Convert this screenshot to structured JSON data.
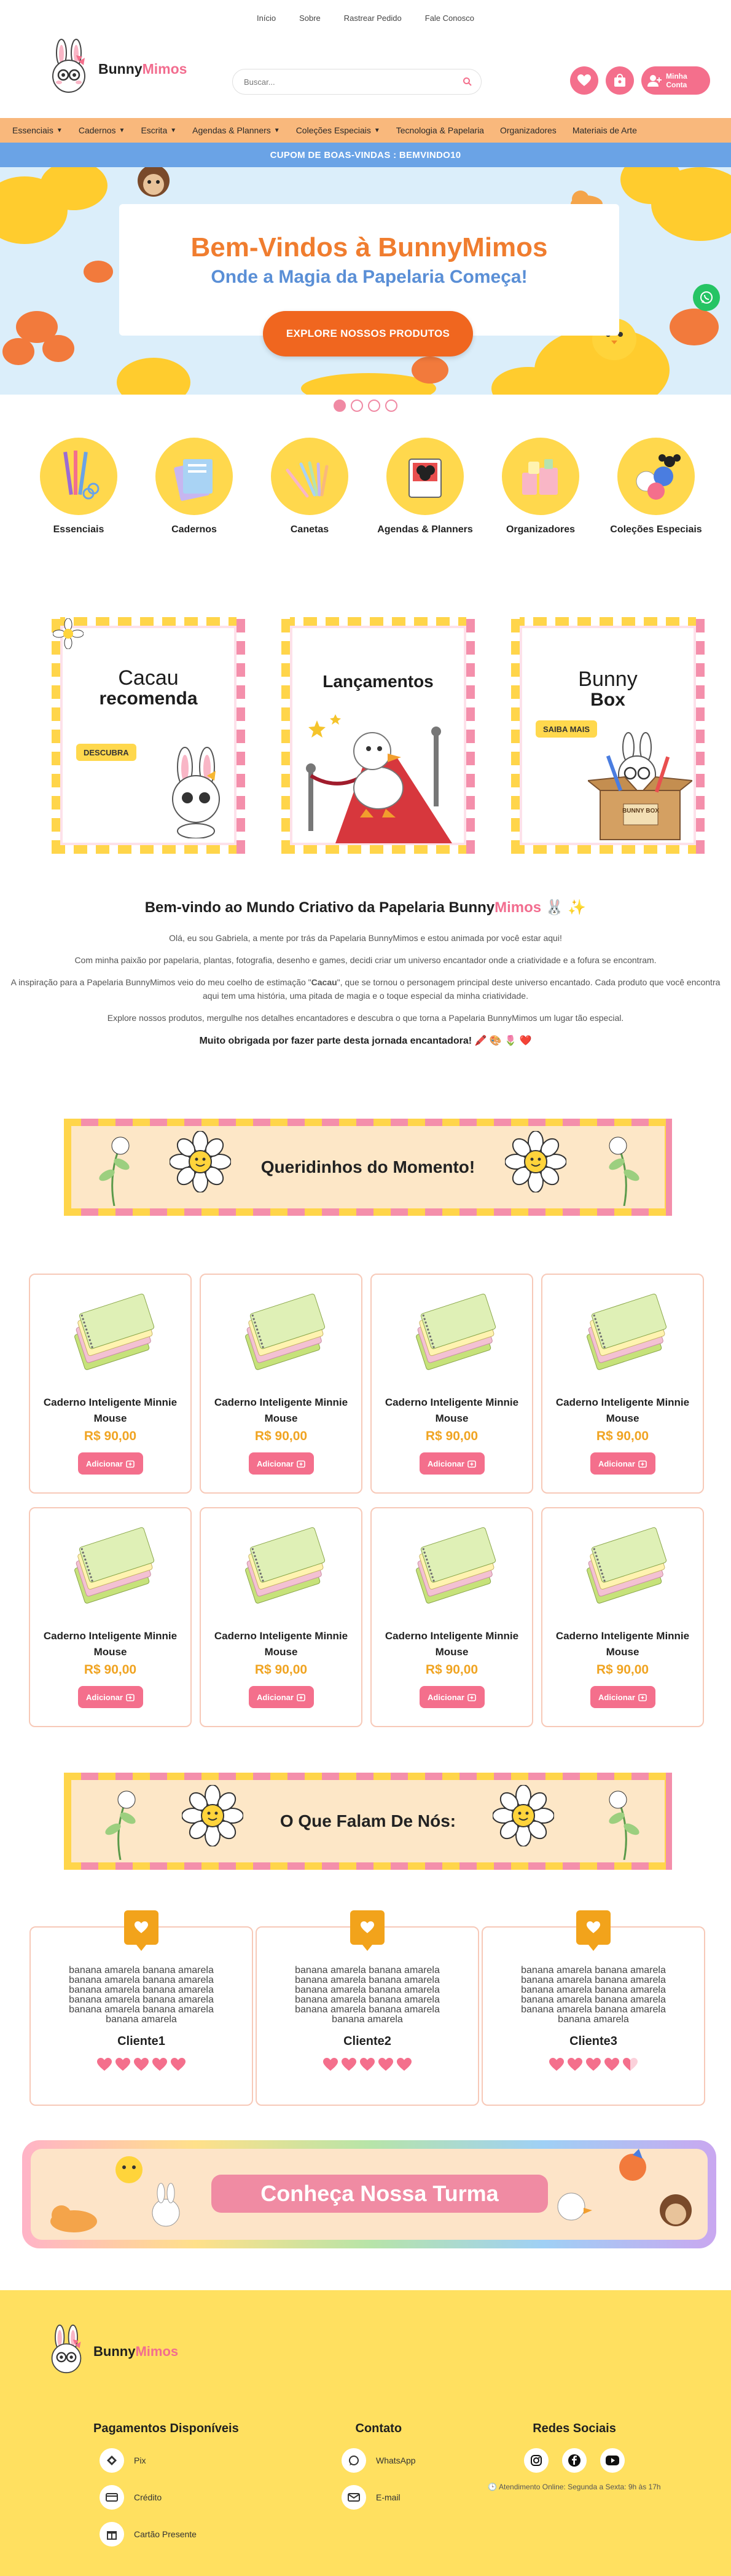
{
  "top_links": [
    "Início",
    "Sobre",
    "Rastrear Pedido",
    "Fale Conosco"
  ],
  "brand": {
    "name_a": "Bunny",
    "name_b": "Mimos"
  },
  "search": {
    "placeholder": "Buscar..."
  },
  "account": {
    "line1": "Minha",
    "line2": "Conta"
  },
  "category_nav": [
    {
      "label": "Essenciais",
      "has_menu": true
    },
    {
      "label": "Cadernos",
      "has_menu": true
    },
    {
      "label": "Escrita",
      "has_menu": true
    },
    {
      "label": "Agendas & Planners",
      "has_menu": true
    },
    {
      "label": "Coleções Especiais",
      "has_menu": true
    },
    {
      "label": "Tecnologia & Papelaria",
      "has_menu": false
    },
    {
      "label": "Organizadores",
      "has_menu": false
    },
    {
      "label": "Materiais de Arte",
      "has_menu": false
    }
  ],
  "coupon": "CUPOM DE BOAS-VINDAS : BEMVINDO10",
  "hero": {
    "title": "Bem-Vindos à BunnyMimos",
    "subtitle": "Onde a Magia da Papelaria Começa!",
    "cta": "EXPLORE NOSSOS PRODUTOS",
    "slides": 4,
    "active_slide": 1
  },
  "categories": [
    {
      "label": "Essenciais"
    },
    {
      "label": "Cadernos"
    },
    {
      "label": "Canetas"
    },
    {
      "label": "Agendas & Planners"
    },
    {
      "label": "Organizadores"
    },
    {
      "label": "Coleções Especiais"
    }
  ],
  "promos": [
    {
      "title_a": "Cacau",
      "title_b": "recomenda",
      "tag": "DESCUBRA"
    },
    {
      "title_a": "Lançamentos",
      "title_b": "",
      "tag": ""
    },
    {
      "title_a": "Bunny",
      "title_b": "Box",
      "tag": "SAIBA MAIS",
      "box_label": "BUNNY BOX"
    }
  ],
  "welcome": {
    "title_a": "Bem-vindo ao Mundo Criativo da Papelaria Bunny",
    "title_b": "Mimos",
    "title_emoji": "🐰 ✨",
    "p1": "Olá, eu sou Gabriela, a mente por trás da Papelaria BunnyMimos e estou animada por você estar aqui!",
    "p2": "Com minha paixão por papelaria, plantas, fotografia, desenho e games, decidi criar um universo encantador onde a criatividade e a fofura se encontram.",
    "p3a": "A inspiração para a Papelaria BunnyMimos veio do meu coelho de estimação \"",
    "p3b": "Cacau",
    "p3c": "\", que se tornou o personagem principal deste universo encantado. Cada produto que você encontra aqui tem uma história, uma pitada de magia e o toque especial da minha criatividade.",
    "p4": "Explore nossos produtos, mergulhe nos detalhes encantadores e descubra o que torna a Papelaria BunnyMimos um lugar tão especial.",
    "thanks": "Muito obrigada por fazer parte desta jornada encantadora! 🖍️ 🎨 🌷 ❤️"
  },
  "section_titles": {
    "favorites": "Queridinhos do Momento!",
    "reviews": "O Que Falam De Nós:"
  },
  "products": [
    {
      "name": "Caderno Inteligente Minnie Mouse",
      "price": "R$ 90,00",
      "button": "Adicionar"
    },
    {
      "name": "Caderno Inteligente Minnie Mouse",
      "price": "R$ 90,00",
      "button": "Adicionar"
    },
    {
      "name": "Caderno Inteligente Minnie Mouse",
      "price": "R$ 90,00",
      "button": "Adicionar"
    },
    {
      "name": "Caderno Inteligente Minnie Mouse",
      "price": "R$ 90,00",
      "button": "Adicionar"
    },
    {
      "name": "Caderno Inteligente Minnie Mouse",
      "price": "R$ 90,00",
      "button": "Adicionar"
    },
    {
      "name": "Caderno Inteligente Minnie Mouse",
      "price": "R$ 90,00",
      "button": "Adicionar"
    },
    {
      "name": "Caderno Inteligente Minnie Mouse",
      "price": "R$ 90,00",
      "button": "Adicionar"
    },
    {
      "name": "Caderno Inteligente Minnie Mouse",
      "price": "R$ 90,00",
      "button": "Adicionar"
    }
  ],
  "testimonials": [
    {
      "text": "banana amarela banana amarela banana amarela banana amarela banana amarela banana amarela banana amarela banana amarela banana amarela banana amarela banana amarela",
      "name": "Cliente1",
      "rating": 5
    },
    {
      "text": "banana amarela banana amarela banana amarela banana amarela banana amarela banana amarela banana amarela banana amarela banana amarela banana amarela banana amarela",
      "name": "Cliente2",
      "rating": 5
    },
    {
      "text": "banana amarela banana amarela banana amarela banana amarela banana amarela banana amarela banana amarela banana amarela banana amarela banana amarela banana amarela",
      "name": "Cliente3",
      "rating": 4.5
    }
  ],
  "turma": "Conheça Nossa Turma",
  "footer": {
    "payments_title": "Pagamentos Disponíveis",
    "payments": [
      "Pix",
      "Crédito",
      "Cartão Presente"
    ],
    "contact_title": "Contato",
    "contacts": [
      "WhatsApp",
      "E-mail"
    ],
    "social_title": "Redes Sociais",
    "socials": [
      "instagram-icon",
      "facebook-icon",
      "youtube-icon"
    ],
    "hours": "🕒 Atendimento Online: Segunda a Sexta: 9h às 17h"
  },
  "colors": {
    "pink": "#f46f8c",
    "orange": "#f07d2f",
    "yellow": "#ffd84d",
    "blue": "#6aa3e6",
    "nav": "#f9b87c",
    "footer": "#ffe060"
  }
}
